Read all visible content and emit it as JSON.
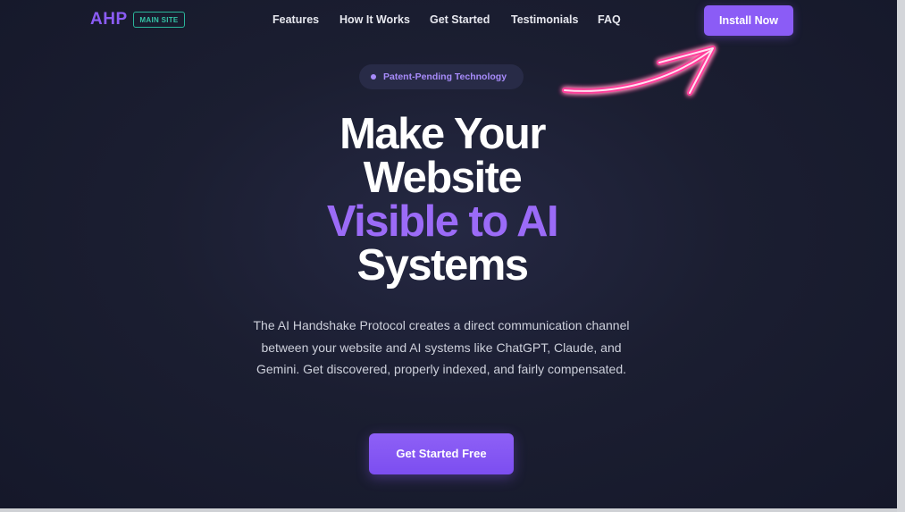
{
  "nav": {
    "brand": "AHP",
    "badge": "MAIN SITE",
    "links": [
      "Features",
      "How It Works",
      "Get Started",
      "Testimonials",
      "FAQ"
    ],
    "install_label": "Install Now"
  },
  "hero": {
    "pill_text": "Patent-Pending Technology",
    "headline_line1": "Make Your",
    "headline_line2": "Website",
    "headline_line3": "Visible to AI",
    "headline_line4": "Systems",
    "description": "The AI Handshake Protocol creates a direct communication channel between your website and AI systems like ChatGPT, Claude, and Gemini. Get discovered, properly indexed, and fairly compensated.",
    "cta_label": "Get Started Free"
  },
  "colors": {
    "accent": "#8b5cf6",
    "badge": "#35c4a6",
    "neon_arrow": "#ff3d9a",
    "background": "#1b1e31"
  },
  "icons": {
    "pill_dot": "dot-icon",
    "annotation": "neon-arrow-icon"
  }
}
